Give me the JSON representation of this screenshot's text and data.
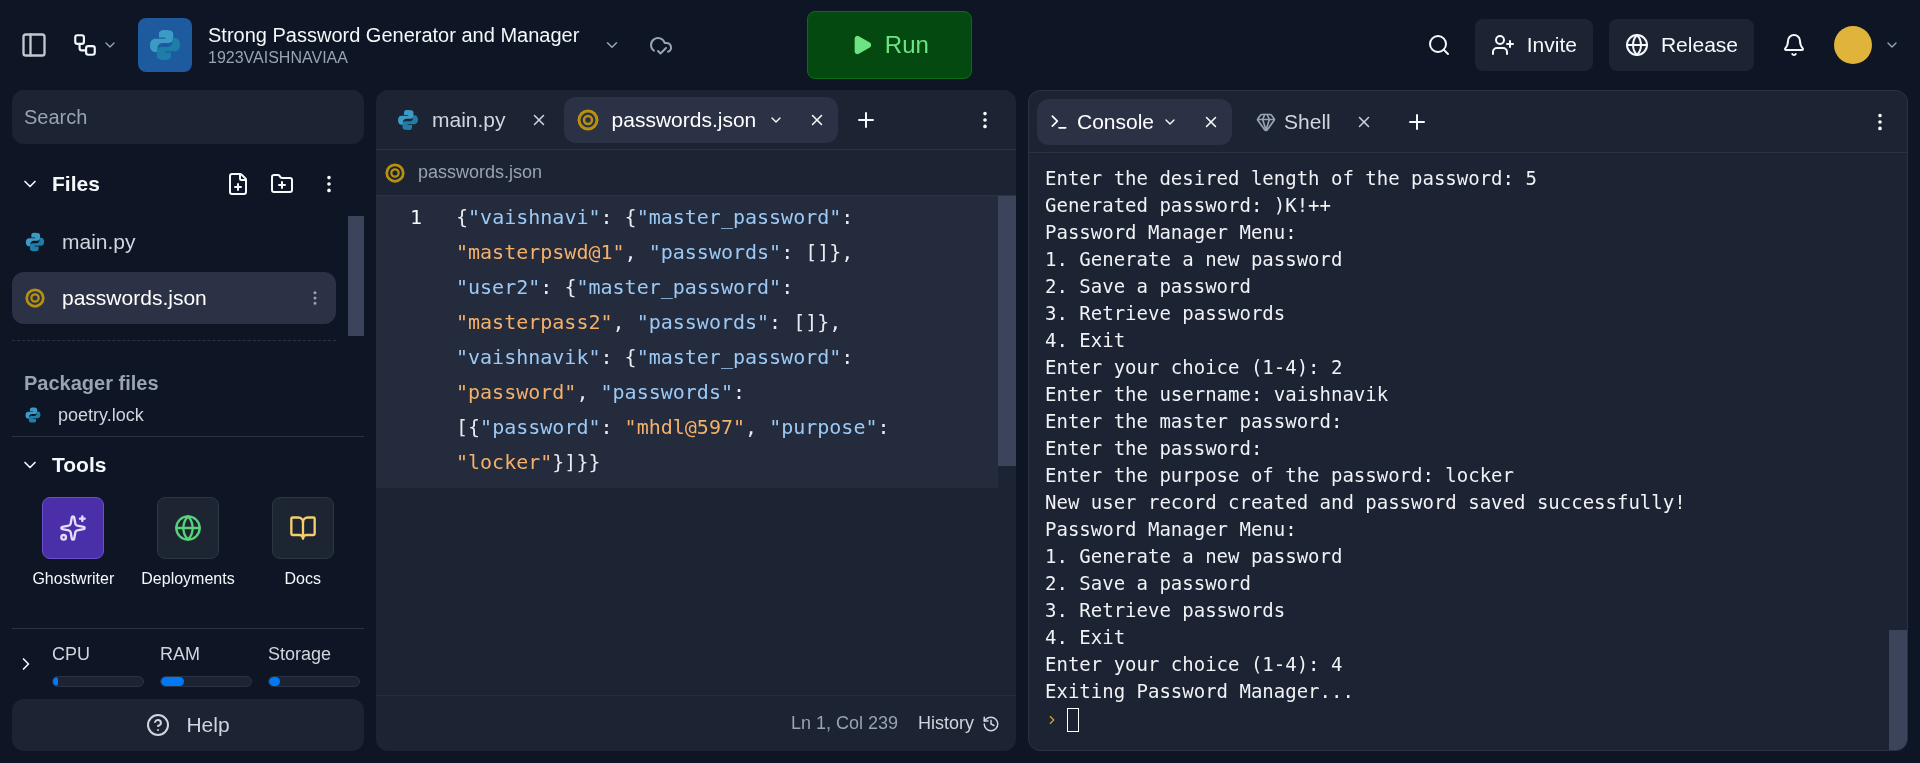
{
  "header": {
    "project_title": "Strong Password Generator and Manager",
    "owner": "1923VAISHNAVIAA",
    "run_label": "Run",
    "invite_label": "Invite",
    "release_label": "Release"
  },
  "sidebar": {
    "search": {
      "placeholder": "Search"
    },
    "files_title": "Files",
    "files": [
      {
        "name": "main.py",
        "kind": "python",
        "selected": false
      },
      {
        "name": "passwords.json",
        "kind": "json",
        "selected": true
      }
    ],
    "packager_title": "Packager files",
    "packager_files": [
      {
        "name": "poetry.lock",
        "kind": "python",
        "selected": false
      }
    ],
    "tools_title": "Tools",
    "tools": [
      {
        "label": "Ghostwriter",
        "kind": "ghost"
      },
      {
        "label": "Deployments",
        "kind": "deploy"
      },
      {
        "label": "Docs",
        "kind": "docs"
      }
    ],
    "meters": [
      {
        "label": "CPU",
        "level": 0.05
      },
      {
        "label": "RAM",
        "level": 0.25
      },
      {
        "label": "Storage",
        "level": 0.12
      }
    ],
    "help_label": "Help"
  },
  "editor": {
    "tabs": [
      {
        "label": "main.py",
        "kind": "python",
        "selected": false
      },
      {
        "label": "passwords.json",
        "kind": "json",
        "selected": true
      }
    ],
    "breadcrumb": "passwords.json",
    "line_number": "1",
    "lines": [
      [
        {
          "text": "{",
          "kind": "punct"
        },
        {
          "text": "\"vaishnavi\"",
          "kind": "key"
        },
        {
          "text": ": {",
          "kind": "punct"
        },
        {
          "text": "\"master_password\"",
          "kind": "key"
        },
        {
          "text": ":",
          "kind": "punct"
        }
      ],
      [
        {
          "text": "\"masterpswd@1\"",
          "kind": "string"
        },
        {
          "text": ", ",
          "kind": "punct"
        },
        {
          "text": "\"passwords\"",
          "kind": "key"
        },
        {
          "text": ": []},",
          "kind": "punct"
        }
      ],
      [
        {
          "text": "\"user2\"",
          "kind": "key"
        },
        {
          "text": ": {",
          "kind": "punct"
        },
        {
          "text": "\"master_password\"",
          "kind": "key"
        },
        {
          "text": ":",
          "kind": "punct"
        }
      ],
      [
        {
          "text": "\"masterpass2\"",
          "kind": "string"
        },
        {
          "text": ", ",
          "kind": "punct"
        },
        {
          "text": "\"passwords\"",
          "kind": "key"
        },
        {
          "text": ": []},",
          "kind": "punct"
        }
      ],
      [
        {
          "text": "\"vaishnavik\"",
          "kind": "key"
        },
        {
          "text": ": {",
          "kind": "punct"
        },
        {
          "text": "\"master_password\"",
          "kind": "key"
        },
        {
          "text": ":",
          "kind": "punct"
        }
      ],
      [
        {
          "text": "\"password\"",
          "kind": "string"
        },
        {
          "text": ", ",
          "kind": "punct"
        },
        {
          "text": "\"passwords\"",
          "kind": "key"
        },
        {
          "text": ":",
          "kind": "punct"
        }
      ],
      [
        {
          "text": "[{",
          "kind": "punct"
        },
        {
          "text": "\"password\"",
          "kind": "key"
        },
        {
          "text": ": ",
          "kind": "punct"
        },
        {
          "text": "\"mhdl@597\"",
          "kind": "string"
        },
        {
          "text": ", ",
          "kind": "punct"
        },
        {
          "text": "\"purpose\"",
          "kind": "key"
        },
        {
          "text": ":",
          "kind": "punct"
        }
      ],
      [
        {
          "text": "\"locker\"",
          "kind": "string"
        },
        {
          "text": "}]}}",
          "kind": "punct"
        }
      ]
    ],
    "cursor_position": "Ln 1, Col 239",
    "history_label": "History"
  },
  "console": {
    "tabs": [
      {
        "label": "Console",
        "kind": "console",
        "selected": true
      },
      {
        "label": "Shell",
        "kind": "shell",
        "selected": false
      }
    ],
    "output": [
      "Enter the desired length of the password: 5",
      "Generated password: )K!++",
      "Password Manager Menu:",
      "1. Generate a new password",
      "2. Save a password",
      "3. Retrieve passwords",
      "4. Exit",
      "Enter your choice (1-4): 2",
      "Enter the username: vaishnavik",
      "Enter the master password:",
      "Enter the password:",
      "Enter the purpose of the password: locker",
      "New user record created and password saved successfully!",
      "Password Manager Menu:",
      "1. Generate a new password",
      "2. Save a password",
      "3. Retrieve passwords",
      "4. Exit",
      "Enter your choice (1-4): 4",
      "Exiting Password Manager..."
    ]
  }
}
